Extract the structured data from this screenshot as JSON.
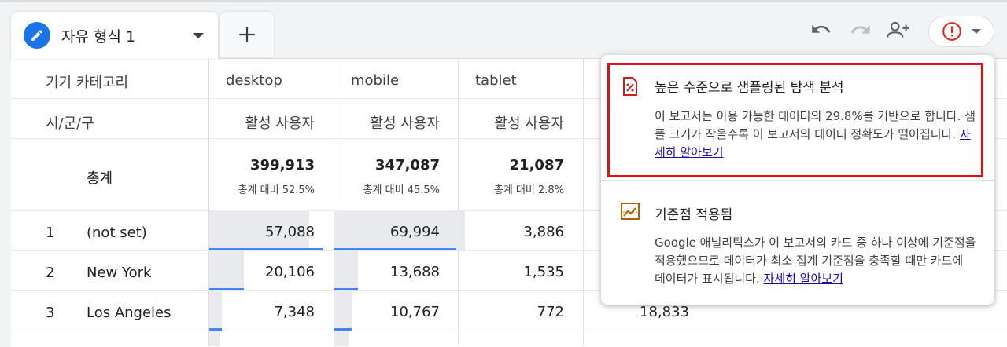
{
  "tabs": {
    "active_title": "자유 형식 1",
    "add_symbol": "+"
  },
  "toolbar": {
    "undo": "undo-icon",
    "redo": "redo-icon",
    "share": "add-person-icon",
    "alert": "error-icon"
  },
  "table": {
    "dim1_header": "기기 카테고리",
    "dim2_header": "시/군/구",
    "columns": [
      {
        "device": "desktop",
        "metric": "활성 사용자",
        "total": "399,913",
        "share": "총계 대비 52.5%"
      },
      {
        "device": "mobile",
        "metric": "활성 사용자",
        "total": "347,087",
        "share": "총계 대비 45.5%"
      },
      {
        "device": "tablet",
        "metric": "활성 사용자",
        "total": "21,087",
        "share": "총계 대비 2.8%"
      }
    ],
    "total_label": "총계",
    "rows": [
      {
        "rank": "1",
        "city": "(not set)",
        "desktop": "57,088",
        "mobile": "69,994",
        "tablet": "3,886",
        "fill_desktop": 0.82,
        "fill_mobile": 1.0,
        "fill_tablet": 0
      },
      {
        "rank": "2",
        "city": "New York",
        "desktop": "20,106",
        "mobile": "13,688",
        "tablet": "1,535",
        "fill_desktop": 0.29,
        "fill_mobile": 0.2,
        "fill_tablet": 0
      },
      {
        "rank": "3",
        "city": "Los Angeles",
        "desktop": "7,348",
        "mobile": "10,767",
        "tablet": "772",
        "hidden": "18,833",
        "fill_desktop": 0.1,
        "fill_mobile": 0.15,
        "fill_tablet": 0
      }
    ]
  },
  "popup": {
    "sampling": {
      "title": "높은 수준으로 샘플링된 탐색 분석",
      "body": "이 보고서는 이용 가능한 데이터의 29.8%를 기반으로 합니다. 샘플 크기가 작을수록 이 보고서의 데이터 정확도가 떨어집니다. ",
      "link": "자세히 알아보기"
    },
    "threshold": {
      "title": "기준점 적용됨",
      "body": "Google 애널리틱스가 이 보고서의 카드 중 하나 이상에 기준점을 적용했으므로 데이터가 최소 집계 기준점을 충족할 때만 카드에 데이터가 표시됩니다. ",
      "link": "자세히 알아보기"
    },
    "highlight_color": "#e3101a"
  }
}
